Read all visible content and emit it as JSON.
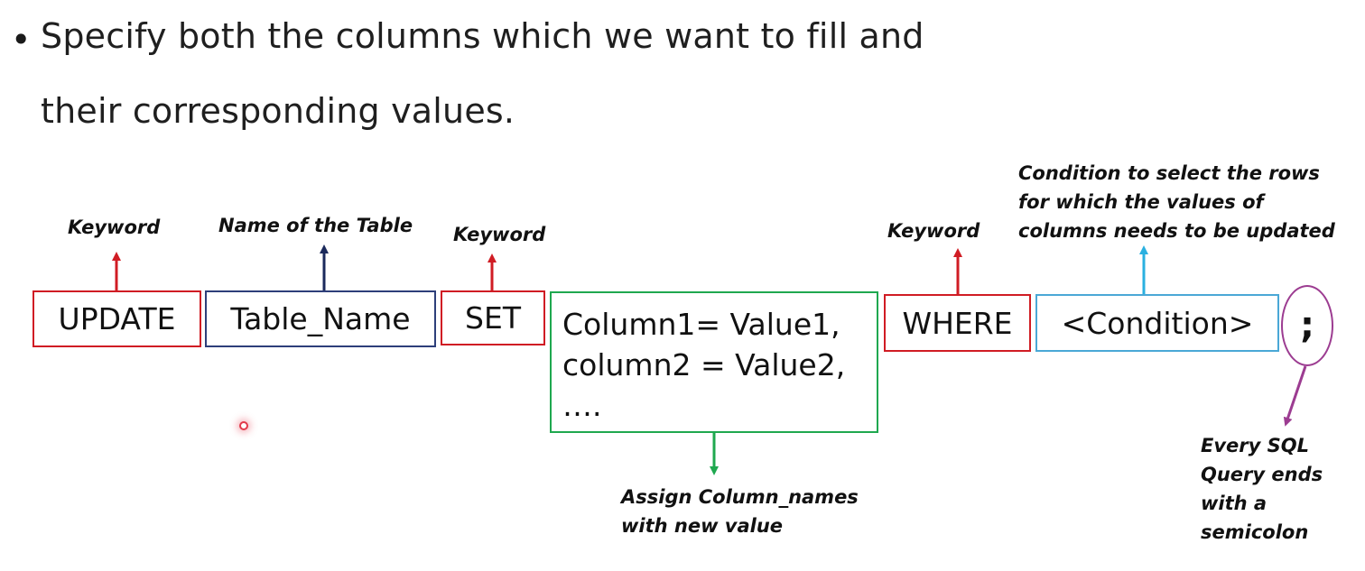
{
  "bullet": {
    "marker": "•",
    "line1": "Specify both the columns which we want to fill and",
    "line2": "their corresponding values."
  },
  "syntax": {
    "update": "UPDATE",
    "table_name": "Table_Name",
    "set": "SET",
    "assignments": [
      "Column1= Value1,",
      "column2 = Value2,",
      "…."
    ],
    "where": "WHERE",
    "condition": "<Condition>",
    "semicolon": ";"
  },
  "labels": {
    "keyword_update": "Keyword",
    "table_name": "Name of the Table",
    "keyword_set": "Keyword",
    "keyword_where": "Keyword",
    "condition": [
      "Condition to select the rows",
      "for which the values  of",
      "columns needs to be updated"
    ],
    "assign": [
      "Assign Column_names",
      "with new value"
    ],
    "semicolon": [
      "Every SQL",
      "Query ends",
      "with a",
      "semicolon"
    ]
  },
  "colors": {
    "keyword": "#d01c24",
    "table": "#2e3f7a",
    "assign": "#1fa84f",
    "condition": "#4aa8d6",
    "semicolon": "#9c3c91",
    "table_arrow": "#1b2a5c"
  }
}
